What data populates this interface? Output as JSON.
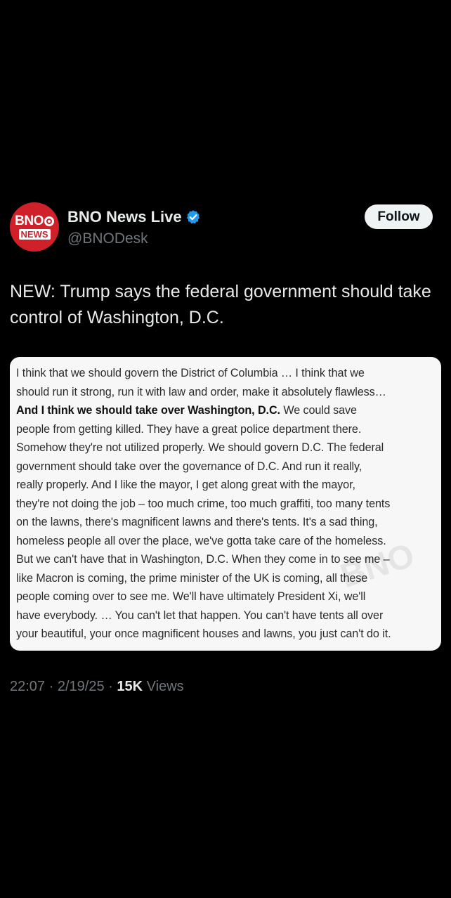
{
  "author": {
    "avatar_top": "BNO",
    "avatar_bottom": "NEWS",
    "display_name": "BNO News Live",
    "handle": "@BNODesk",
    "verified_icon": "verified-badge-icon",
    "verified_color": "#1d9bf0"
  },
  "follow_label": "Follow",
  "tweet_text": "NEW: Trump says the federal government should take control of Washington, D.C.",
  "quote": {
    "lines": [
      "I think that we should govern the District of Columbia … I think that we",
      "should run it strong, run it with law and order, make it absolutely flawless…",
      "We could save",
      "people from getting killed. They have a great police department there.",
      "Somehow they're not utilized properly. We should govern D.C. The federal",
      "government should take over the governance of D.C. And run it really,",
      "really properly. And I like the mayor, I get along great with the mayor,",
      "they're not doing the job – too much crime, too much graffiti, too many tents",
      "on the lawns, there's magnificent lawns and there's tents. It's a sad thing,",
      "homeless people all over the place, we've gotta take care of the homeless.",
      "But we can't have that in Washington, D.C. When they come in to see me –",
      "like Macron is coming, the prime minister of the UK is coming, all these",
      "people coming over to see me. We'll have ultimately President Xi, we'll",
      "have everybody. … You can't let that happen. You can't have tents all over",
      "your beautiful, your once magnificent houses and lawns, you just can't do it."
    ],
    "bold_phrase": "And I think we should take over Washington, D.C.",
    "watermark": "BNO"
  },
  "meta": {
    "time": "22:07",
    "date": "2/19/25",
    "separator": "·",
    "views_count": "15K",
    "views_label": "Views"
  }
}
